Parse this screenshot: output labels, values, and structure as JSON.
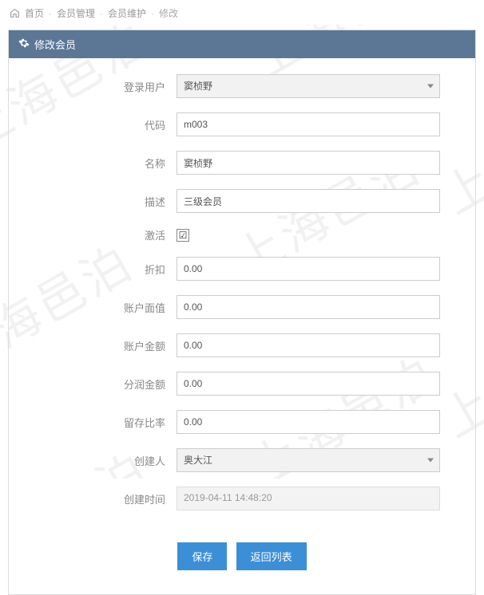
{
  "watermark": "上海邑泊",
  "breadcrumb": {
    "home": "首页",
    "l1": "会员管理",
    "l2": "会员维护",
    "l3": "修改"
  },
  "panel": {
    "title": "修改会员"
  },
  "form": {
    "login_user": {
      "label": "登录用户",
      "value": "窦桢野"
    },
    "code": {
      "label": "代码",
      "value": "m003"
    },
    "name": {
      "label": "名称",
      "value": "窦桢野"
    },
    "desc": {
      "label": "描述",
      "value": "三级会员"
    },
    "active": {
      "label": "激活",
      "checked": true
    },
    "discount": {
      "label": "折扣",
      "value": "0.00"
    },
    "face_value": {
      "label": "账户面值",
      "value": "0.00"
    },
    "balance": {
      "label": "账户金额",
      "value": "0.00"
    },
    "dividend": {
      "label": "分润金额",
      "value": "0.00"
    },
    "retain_rate": {
      "label": "留存比率",
      "value": "0.00"
    },
    "creator": {
      "label": "创建人",
      "value": "奥大江"
    },
    "created_at": {
      "label": "创建时间",
      "value": "2019-04-11 14:48:20"
    }
  },
  "buttons": {
    "save": "保存",
    "back": "返回列表"
  }
}
